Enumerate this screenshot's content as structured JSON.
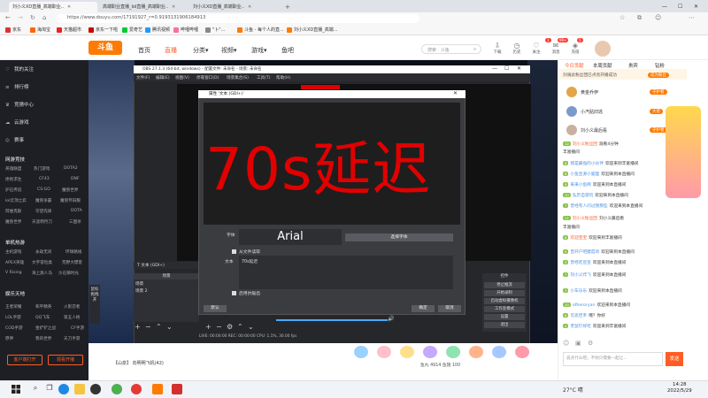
{
  "browser": {
    "tabs": [
      {
        "label": "刘小义XD直播_高端职业..",
        "active": true
      },
      {
        "label": "高端职业直播_lol直播_高端职业..",
        "active": false
      },
      {
        "label": "刘小义XD直播_高端职业..",
        "active": false
      }
    ],
    "url": "https://www.douyu.com/17191927_r=0.9193131906184913",
    "favorites": [
      "京东",
      "海淘宝",
      "天猫超市",
      "京东一下啦",
      "爱奇艺",
      "腾讯视频",
      "哔哩哔哩",
      "\"卜\"...",
      "斗鱼 - 每个人的直...",
      "刘小义XD直播_高端..."
    ]
  },
  "site": {
    "logo": "斗鱼",
    "nav": [
      "首页",
      "直播",
      "分类",
      "视频",
      "游戏",
      "鱼吧"
    ],
    "active_nav": "直播",
    "search_placeholder": "搜索 · 斗鱼",
    "header_icons": [
      "下载",
      "历史",
      "关注",
      "消息",
      "充值"
    ],
    "badges": [
      "1",
      "99+",
      "5"
    ]
  },
  "sidebar": {
    "items": [
      {
        "icon": "heart-icon",
        "label": "我的关注"
      },
      {
        "icon": "list-icon",
        "label": "排行榜"
      },
      {
        "icon": "trophy-icon",
        "label": "竞猜中心"
      },
      {
        "icon": "cloud-icon",
        "label": "云游戏"
      },
      {
        "icon": "match-icon",
        "label": "赛事"
      }
    ],
    "sections": [
      {
        "title": "网游竞技",
        "tags": [
          "英雄联盟",
          "热门游戏",
          "DOTA2",
          "绝地求生",
          "CF43",
          "DNF",
          "炉石传说",
          "CS:GO",
          "魔兽世界",
          "lol云顶之弈",
          "魔兽争霸",
          "魔兽怀旧服",
          "阿维克斯",
          "守望先锋",
          "DOTA",
          "魔兽世界",
          "天涯明月刀",
          "三国杀"
        ]
      },
      {
        "title": "单机热游",
        "tags": [
          "主机游戏",
          "永劫无间",
          "环球路线",
          "APEX英雄",
          "文字冒险类",
          "荒野大镖客",
          "V Rising",
          "海上旗人马",
          "沙石镇时光"
        ]
      },
      {
        "title": "娱乐天地",
        "tags": [
          "王者荣耀",
          "和平精英",
          "火影忍者",
          "LOL手游",
          "QQ飞车",
          "第五人格",
          "COD手游",
          "金铲铲之战",
          "CF手游",
          "原神",
          "我的世界",
          "天刀手游"
        ]
      }
    ],
    "bottom_buttons": [
      "客户端打开",
      "观看开播"
    ]
  },
  "obs": {
    "title": "OBS 27.1.3 (64-bit, windows) - 配置文件: 未命名 - 场景: 未命名",
    "menu": [
      "文件(F)",
      "编辑(E)",
      "视图(V)",
      "停靠窗口(D)",
      "场景集合(S)",
      "工具(T)",
      "帮助(H)"
    ],
    "sources_bar": "文本 (GDI+)",
    "scenes_header": "场景",
    "scenes": [
      "场景",
      "场景 2"
    ],
    "side_handle": "鼠标拖拽开",
    "controls_header": "控件",
    "controls": [
      "停止推流",
      "开始录制",
      "启动虚拟摄像机",
      "工作室模式",
      "设置",
      "退出"
    ],
    "status": "LIVE: 00:00:00  REC: 00:00:00  CPU: 1.1%, 30.00 fps",
    "volume_label": "音量"
  },
  "dialog": {
    "title": "属性 '文本 (GDI+)'",
    "preview_text": "70s延迟",
    "font_label": "字体",
    "font_name": "Arial",
    "font_button": "选择字体",
    "from_file_label": "从文件读取",
    "text_label": "文本",
    "text_value": "70s延迟",
    "antialias_label": "启用抗锯齿",
    "default_button": "默认",
    "ok_button": "确定",
    "cancel_button": "取消"
  },
  "stream_info": {
    "bubble": "【山泉】 向明明飞机(42)",
    "stats": "鱼丸 4914  鱼翅 100"
  },
  "chat": {
    "tabs": [
      "今日贡献",
      "本周贡献",
      "贵宾",
      "钻粉"
    ],
    "active_tab": "今日贡献",
    "top_text": "剑骑此粉丝团已点亮开播成功",
    "ranks": [
      {
        "name": "黄金乔伊",
        "tag": "守护者",
        "color": "#e2a54a"
      },
      {
        "name": "小汽贴旧逃",
        "tag": "大佬",
        "color": "#7b9acc"
      },
      {
        "name": "刘小义最后看",
        "tag": "守护者",
        "color": "#c9b0a0"
      }
    ],
    "messages": [
      {
        "lv": "12",
        "name": "刘小义粉丝团",
        "text": "观看4分钟"
      },
      {
        "lv": "",
        "name": "",
        "text": "丰富播间"
      },
      {
        "lv": "8",
        "name": "我是最强的小伙伴",
        "text": "欢迎来到丰富播间"
      },
      {
        "lv": "6",
        "name": "小鱼豆源小狐狸",
        "text": "欢迎来到本直播间"
      },
      {
        "lv": "9",
        "name": "来来小鱼啊",
        "text": "欢迎来到本直播间"
      },
      {
        "lv": "10",
        "name": "弘历自游玩",
        "text": "欢迎来到本直播间"
      },
      {
        "lv": "7",
        "name": "曾经有人问过我那些",
        "text": "欢迎来到本直播间"
      },
      {
        "lv": "11",
        "name": "刘小义粉丝团",
        "text": "刘小义最后看"
      },
      {
        "lv": "",
        "name": "",
        "text": "丰富播间"
      },
      {
        "lv": "8",
        "name": "欢迎宝宝",
        "text": "欢迎来到丰富播间"
      },
      {
        "lv": "5",
        "name": "曾开户吧蘑菇哥",
        "text": "欢迎来到本直播间"
      },
      {
        "lv": "9",
        "name": "曾经吃豆豆",
        "text": "欢迎来到本直播间"
      },
      {
        "lv": "7",
        "name": "刘小义炸飞",
        "text": "欢迎来到本直播间"
      },
      {
        "lv": "3",
        "name": "小车乐乐",
        "text": "欢迎来到本直播间"
      },
      {
        "lv": "10",
        "name": "ofheroryan",
        "text": "欢迎来到本直播间"
      },
      {
        "lv": "6",
        "name": "可恶佳禾",
        "text": "哦？你好"
      },
      {
        "lv": "4",
        "name": "老鼠钉好吃",
        "text": "欢迎来到丰富播间"
      }
    ],
    "input_placeholder": "说点什么吧，不你只需要一起让...",
    "send_label": "发送"
  },
  "taskbar": {
    "weather": "27°C 晴",
    "time": "14:28",
    "date": "2022/5/29"
  },
  "colors": {
    "accent": "#ff5d23",
    "obs_bg": "#26272b",
    "red_text": "#e10000"
  }
}
